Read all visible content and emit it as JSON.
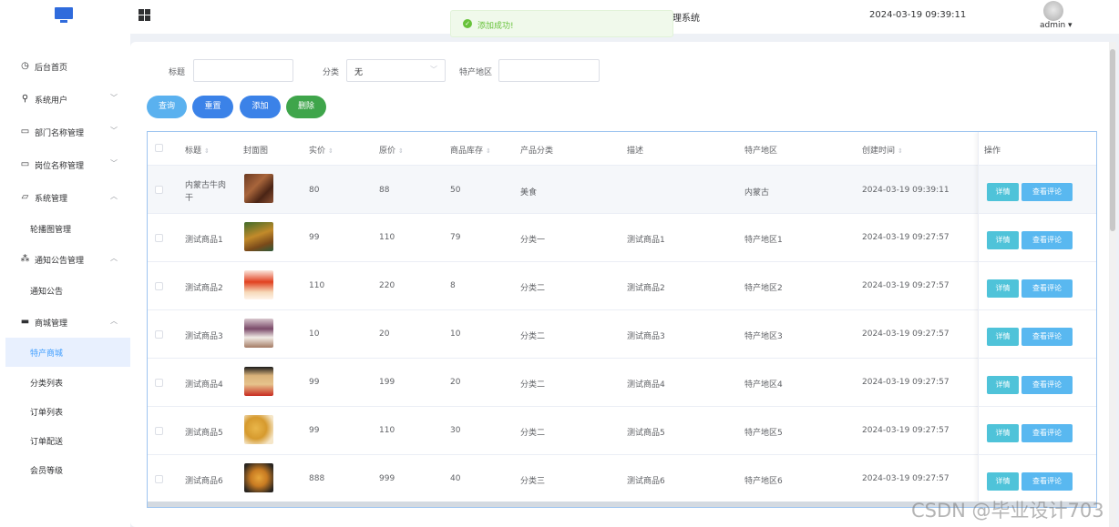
{
  "header": {
    "system_title": "理系统",
    "datetime": "2024-03-19 09:39:11",
    "user": "admin ▾"
  },
  "toast": {
    "message": "添加成功!"
  },
  "sidebar": {
    "items": [
      {
        "label": "后台首页",
        "icon": "clock-icon"
      },
      {
        "label": "系统用户",
        "icon": "user-icon"
      },
      {
        "label": "部门名称管理",
        "icon": "card-icon"
      },
      {
        "label": "岗位名称管理",
        "icon": "card-icon"
      },
      {
        "label": "系统管理",
        "icon": "folder-icon"
      },
      {
        "label": "轮播图管理",
        "icon": ""
      },
      {
        "label": "通知公告管理",
        "icon": "spark-icon"
      },
      {
        "label": "通知公告",
        "icon": ""
      },
      {
        "label": "商城管理",
        "icon": "chair-icon"
      },
      {
        "label": "特产商城",
        "icon": ""
      },
      {
        "label": "分类列表",
        "icon": ""
      },
      {
        "label": "订单列表",
        "icon": ""
      },
      {
        "label": "订单配送",
        "icon": ""
      },
      {
        "label": "会员等级",
        "icon": ""
      }
    ]
  },
  "search": {
    "title_label": "标题",
    "title_value": "",
    "category_label": "分类",
    "category_value": "无",
    "region_label": "特产地区",
    "region_value": ""
  },
  "buttons": {
    "query": "查询",
    "reset": "重置",
    "add": "添加",
    "delete": "删除"
  },
  "table": {
    "headers": [
      "标题",
      "封面图",
      "实价",
      "原价",
      "商品库存",
      "产品分类",
      "描述",
      "特产地区",
      "创建时间",
      "操作"
    ],
    "rows": [
      {
        "title": "内蒙古牛肉",
        "title2": "干",
        "price": "80",
        "orig": "88",
        "stock": "50",
        "cat": "美食",
        "desc": "",
        "region": "内蒙古",
        "time": "2024-03-19 09:39:11"
      },
      {
        "title": "测试商品1",
        "title2": "",
        "price": "99",
        "orig": "110",
        "stock": "79",
        "cat": "分类一",
        "desc": "测试商品1",
        "region": "特产地区1",
        "time": "2024-03-19 09:27:57"
      },
      {
        "title": "测试商品2",
        "title2": "",
        "price": "110",
        "orig": "220",
        "stock": "8",
        "cat": "分类二",
        "desc": "测试商品2",
        "region": "特产地区2",
        "time": "2024-03-19 09:27:57"
      },
      {
        "title": "测试商品3",
        "title2": "",
        "price": "10",
        "orig": "20",
        "stock": "10",
        "cat": "分类二",
        "desc": "测试商品3",
        "region": "特产地区3",
        "time": "2024-03-19 09:27:57"
      },
      {
        "title": "测试商品4",
        "title2": "",
        "price": "99",
        "orig": "199",
        "stock": "20",
        "cat": "分类二",
        "desc": "测试商品4",
        "region": "特产地区4",
        "time": "2024-03-19 09:27:57"
      },
      {
        "title": "测试商品5",
        "title2": "",
        "price": "99",
        "orig": "110",
        "stock": "30",
        "cat": "分类二",
        "desc": "测试商品5",
        "region": "特产地区5",
        "time": "2024-03-19 09:27:57"
      },
      {
        "title": "测试商品6",
        "title2": "",
        "price": "888",
        "orig": "999",
        "stock": "40",
        "cat": "分类三",
        "desc": "测试商品6",
        "region": "特产地区6",
        "time": "2024-03-19 09:27:57"
      }
    ],
    "detail_label": "详情",
    "review_label": "查看评论"
  },
  "colors": {
    "primary": "#409eff",
    "query": "#5ab1ef",
    "reset": "#3b82e8",
    "add": "#3b82e8",
    "delete": "#3fa54b",
    "success": "#67c23a"
  },
  "watermark": "CSDN @毕业设计703"
}
